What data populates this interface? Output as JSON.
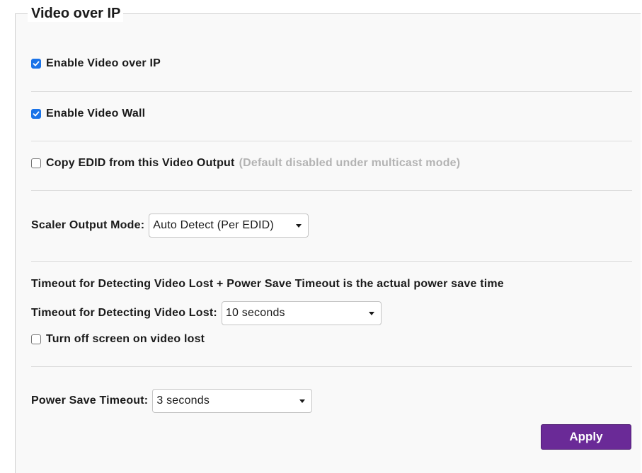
{
  "section": {
    "title": "Video over IP"
  },
  "options": {
    "enable_voip": {
      "label": "Enable Video over IP",
      "checked": true
    },
    "enable_video_wall": {
      "label": "Enable Video Wall",
      "checked": true
    },
    "copy_edid": {
      "label": "Copy EDID from this Video Output",
      "hint": "(Default disabled under multicast mode)",
      "checked": false
    },
    "turn_off_screen": {
      "label": "Turn off screen on video lost",
      "checked": false
    }
  },
  "scaler": {
    "label": "Scaler Output Mode:",
    "selected": "Auto Detect (Per EDID)"
  },
  "timeout": {
    "note": "Timeout for Detecting Video Lost + Power Save Timeout is the actual power save time",
    "label": "Timeout for Detecting Video Lost:",
    "selected": "10 seconds"
  },
  "power_save": {
    "label": "Power Save Timeout:",
    "selected": "3 seconds"
  },
  "actions": {
    "apply_label": "Apply"
  },
  "colors": {
    "accent_checkbox": "#1a73e8",
    "apply_button": "#6a2a97",
    "hint_text": "#b3b3b3"
  }
}
